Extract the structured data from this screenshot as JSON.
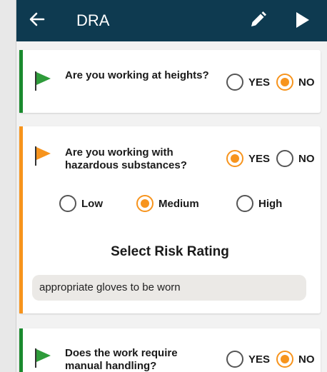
{
  "appbar": {
    "title": "DRA",
    "background": "#0e3a50"
  },
  "colors": {
    "accent": "#f7941d",
    "green": "#1a8a2e"
  },
  "questions": [
    {
      "text": "Are you working at heights?",
      "flag_color": "#1a8a2e",
      "options": [
        "YES",
        "NO"
      ],
      "selected": "NO"
    },
    {
      "text": "Are you working with hazardous substances?",
      "flag_color": "#f7941d",
      "options": [
        "YES",
        "NO"
      ],
      "selected": "YES",
      "risk_levels": [
        "Low",
        "Medium",
        "High"
      ],
      "risk_selected": "Medium",
      "risk_heading": "Select Risk Rating",
      "note": "appropriate gloves to be worn"
    },
    {
      "text": "Does the work require manual handling?",
      "flag_color": "#1a8a2e",
      "options": [
        "YES",
        "NO"
      ],
      "selected": "NO"
    }
  ],
  "icons": [
    "back-arrow-icon",
    "pencil-icon",
    "play-icon",
    "flag-icon"
  ]
}
